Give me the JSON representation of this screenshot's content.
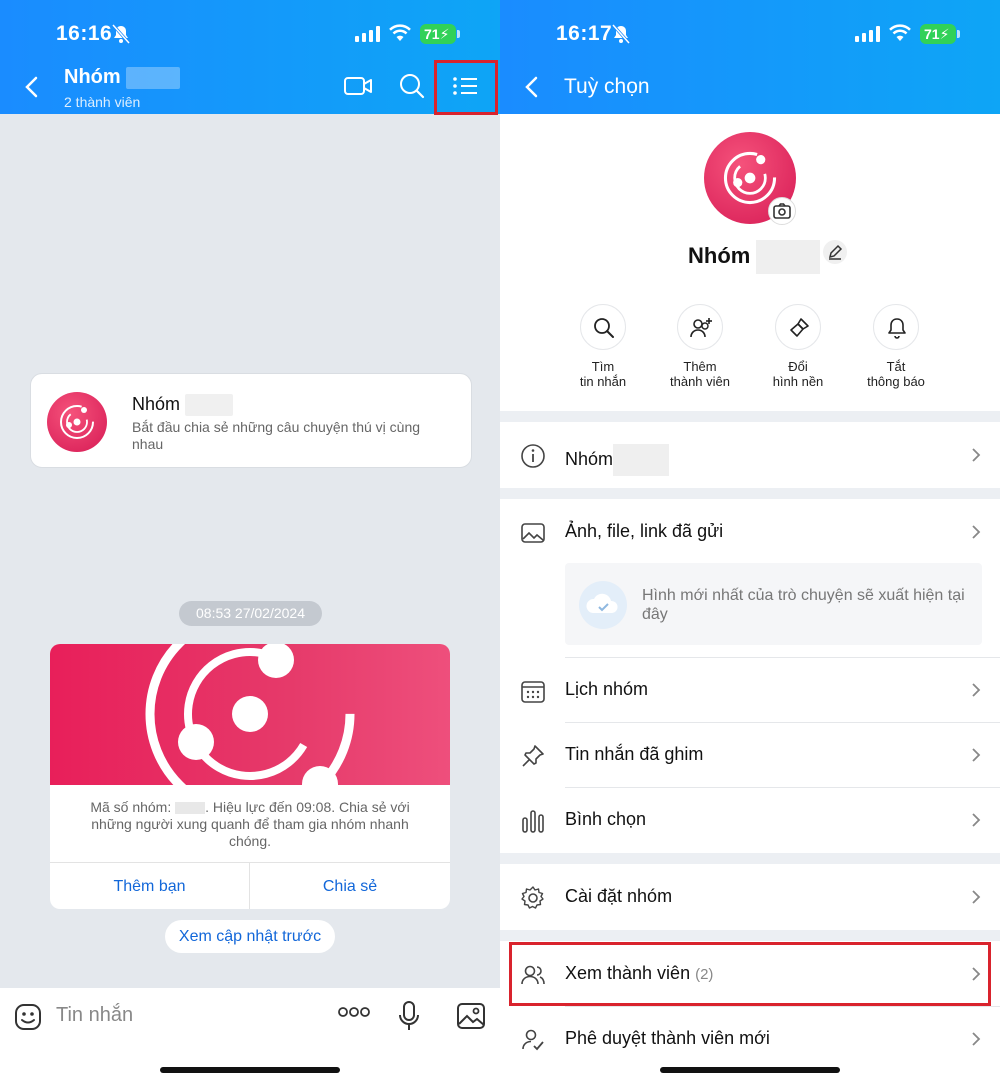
{
  "left": {
    "status": {
      "time": "16:16",
      "battery": "71"
    },
    "header": {
      "group_name": "Nhóm",
      "subtitle": "2 thành viên"
    },
    "intro_card": {
      "title": "Nhóm",
      "text": "Bắt đầu chia sẻ những câu chuyện thú vị cùng nhau"
    },
    "date_pill": "08:53 27/02/2024",
    "invite_card": {
      "text_before": "Mã số nhóm:",
      "text_after": ". Hiệu lực đến 09:08. Chia sẻ với những người xung quanh để tham gia nhóm nhanh chóng.",
      "add_friend": "Thêm bạn",
      "share": "Chia sẻ"
    },
    "view_previous": "Xem cập nhật trước",
    "input": {
      "placeholder": "Tin nhắn"
    }
  },
  "right": {
    "status": {
      "time": "16:17",
      "battery": "71"
    },
    "header": {
      "title": "Tuỳ chọn"
    },
    "profile": {
      "name": "Nhóm"
    },
    "actions": [
      {
        "line1": "Tìm",
        "line2": "tin nhắn",
        "icon": "search-icon"
      },
      {
        "line1": "Thêm",
        "line2": "thành viên",
        "icon": "add-member-icon"
      },
      {
        "line1": "Đổi",
        "line2": "hình nền",
        "icon": "brush-icon"
      },
      {
        "line1": "Tắt",
        "line2": "thông báo",
        "icon": "bell-icon"
      }
    ],
    "rows": {
      "info": "Nhóm",
      "media": "Ảnh, file, link đã gửi",
      "media_empty": "Hình mới nhất của trò chuyện sẽ xuất hiện tại đây",
      "calendar": "Lịch nhóm",
      "pinned": "Tin nhắn đã ghim",
      "poll": "Bình chọn",
      "settings": "Cài đặt nhóm",
      "members": "Xem thành viên",
      "members_count": "(2)",
      "approve": "Phê duyệt thành viên mới"
    }
  },
  "colors": {
    "header": "#1a8cff",
    "accent": "#e81f5a",
    "highlight": "#d9232d",
    "link": "#1267d9"
  }
}
